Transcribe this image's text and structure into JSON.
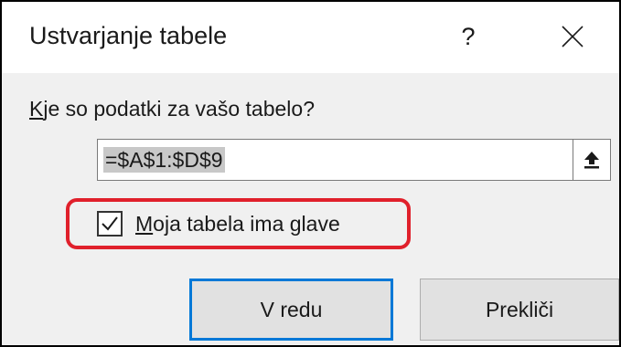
{
  "dialog": {
    "title": "Ustvarjanje tabele",
    "help_label": "?",
    "close_icon": "close-icon"
  },
  "range": {
    "question_accel": "K",
    "question_rest": "je so podatki za vašo tabelo?",
    "value": "=$A$1:$D$9",
    "collapse_icon": "collapse-dialog-icon"
  },
  "headers_option": {
    "accel": "M",
    "label_rest": "oja tabela ima glave",
    "checked": true
  },
  "buttons": {
    "ok": "V redu",
    "cancel": "Prekliči"
  },
  "colors": {
    "highlight": "#e0202b",
    "focus_border": "#0078d7",
    "body_bg": "#f0f0f0",
    "selection_bg": "#c8c8c8"
  }
}
